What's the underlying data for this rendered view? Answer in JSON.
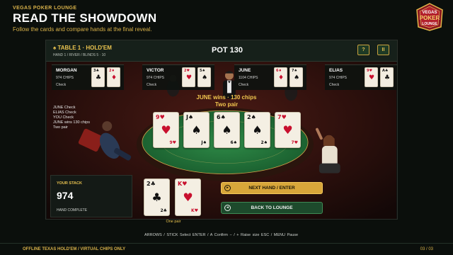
{
  "header": {
    "brand": "VEGAS POKER LOUNGE",
    "title": "READ THE SHOWDOWN",
    "subtitle": "Follow the cards and compare hands at the final reveal."
  },
  "logo": {
    "line1": "VEGAS",
    "line2": "POKER",
    "line3": "LOUNGE"
  },
  "table": {
    "name": "♠ TABLE 1 · HOLD'EM",
    "info": "HAND 1  /  RIVER  /  BLINDS 5 · 10",
    "pot": "POT  130",
    "help_label": "?",
    "pause_label": "II"
  },
  "seats": [
    {
      "name": "MORGAN",
      "chips": "974 CHIPS",
      "action": "Check",
      "cards": [
        {
          "rank": "3",
          "suit": "♣",
          "color": "black"
        },
        {
          "rank": "2",
          "suit": "♦",
          "color": "red"
        }
      ]
    },
    {
      "name": "VICTOR",
      "chips": "974 CHIPS",
      "action": "Check",
      "cards": [
        {
          "rank": "2",
          "suit": "♥",
          "color": "red"
        },
        {
          "rank": "5",
          "suit": "♠",
          "color": "black"
        }
      ]
    },
    {
      "name": "JUNE",
      "chips": "1104 CHIPS",
      "action": "Check",
      "cards": [
        {
          "rank": "6",
          "suit": "♦",
          "color": "red"
        },
        {
          "rank": "7",
          "suit": "♠",
          "color": "black"
        }
      ]
    },
    {
      "name": "ELIAS",
      "chips": "974 CHIPS",
      "action": "Check",
      "cards": [
        {
          "rank": "9",
          "suit": "♥",
          "color": "red"
        },
        {
          "rank": "A",
          "suit": "♣",
          "color": "black"
        }
      ]
    }
  ],
  "log": [
    "JUNE    Check",
    "ELIAS    Check",
    "YOU    Check",
    "JUNE wins    130 chips",
    "Two pair"
  ],
  "winner": {
    "line1": "JUNE wins  ·  130 chips",
    "line2": "Two pair"
  },
  "board": [
    {
      "rank": "9",
      "suit": "♥",
      "color": "red"
    },
    {
      "rank": "J",
      "suit": "♠",
      "color": "black"
    },
    {
      "rank": "6",
      "suit": "♠",
      "color": "black"
    },
    {
      "rank": "2",
      "suit": "♠",
      "color": "black"
    },
    {
      "rank": "7",
      "suit": "♥",
      "color": "red"
    }
  ],
  "player_hand": {
    "cards": [
      {
        "rank": "2",
        "suit": "♣",
        "color": "black"
      },
      {
        "rank": "K",
        "suit": "♥",
        "color": "red"
      }
    ],
    "label": "One pair"
  },
  "stack": {
    "label": "YOUR STACK",
    "value": "974",
    "status": "HAND COMPLETE"
  },
  "buttons": {
    "next": "NEXT HAND  /  ENTER",
    "back": "BACK TO LOUNGE",
    "next_icon": "▸",
    "back_icon": "◂"
  },
  "controls": "ARROWS / STICK  Select     ENTER / A  Confirm     − / +  Raise size     ESC / MENU  Pause",
  "footer": {
    "left": "OFFLINE TEXAS HOLD'EM  /  VIRTUAL CHIPS ONLY",
    "page": "03 / 03"
  },
  "colors": {
    "accent": "#d9b24a",
    "felt": "#1f6b35",
    "rail": "#2a150d",
    "button_gold": "#d8a63a",
    "button_green": "#1d4a2c"
  }
}
